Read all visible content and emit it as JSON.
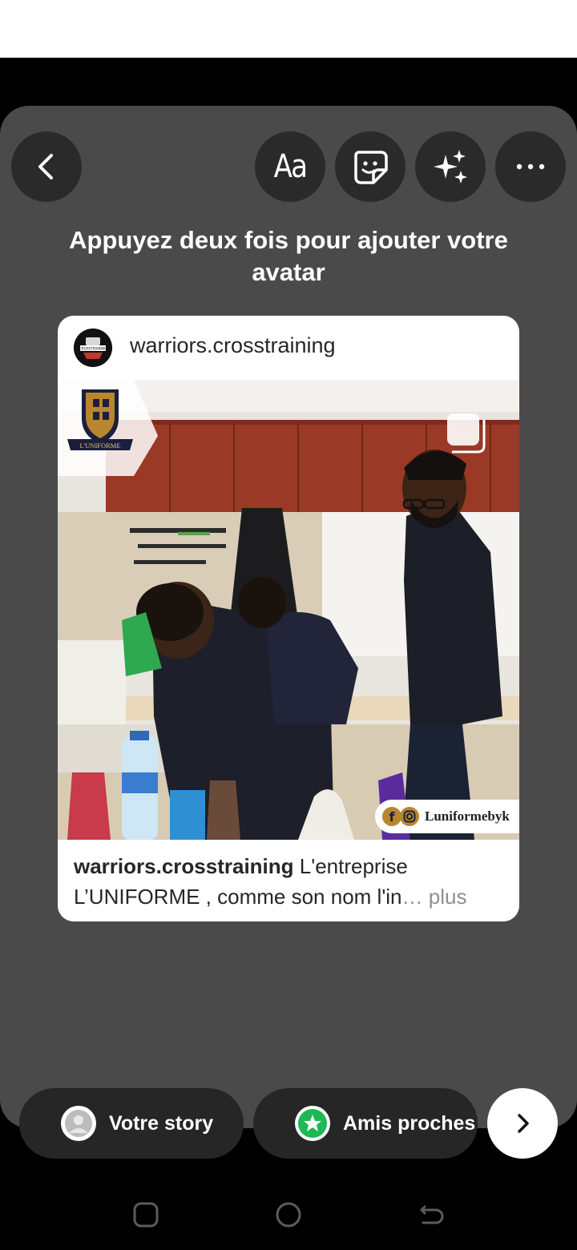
{
  "top_toolbar": {
    "back_icon": "chevron-left-icon",
    "text_tool_label": "Aa",
    "sticker_icon": "sticker-icon",
    "effects_icon": "sparkles-icon",
    "more_icon": "more-horizontal-icon"
  },
  "hint_text": "Appuyez deux fois pour ajouter votre avatar",
  "post_card": {
    "username": "warriors.crosstraining",
    "avatar_text": "CROSSTRAINING",
    "photo_logo_text": "L'UNIFORME",
    "watermark_handle": "Luniformebyk",
    "caption_user": "warriors.crosstraining",
    "caption_text": " L'entreprise L’UNIFORME , comme son nom l'in",
    "caption_ellipsis": "… ",
    "caption_more": "plus"
  },
  "bottom_bar": {
    "your_story_label": "Votre story",
    "close_friends_label": "Amis proches",
    "close_friends_color": "#1db954",
    "next_icon": "chevron-right-icon"
  },
  "system_nav": {
    "recents_icon": "recents-icon",
    "home_icon": "home-icon",
    "back_icon": "back-icon"
  }
}
